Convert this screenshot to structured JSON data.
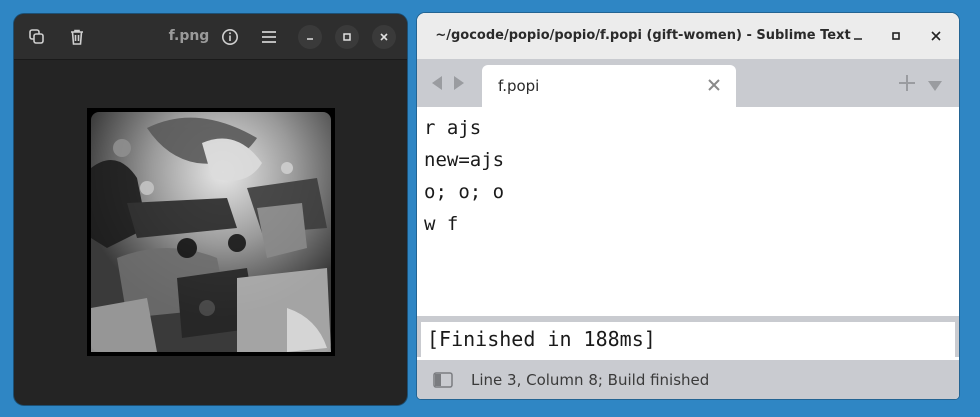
{
  "viewer": {
    "title": "f.png",
    "icons": [
      "copy-icon",
      "trash-icon",
      "info-icon",
      "menu-icon",
      "minimize-icon",
      "maximize-icon",
      "close-icon"
    ]
  },
  "sublime": {
    "window_title": "~/gocode/popio/popio/f.popi (gift-women) - Sublime Text",
    "tab_label": "f.popi",
    "code_lines": [
      "r ajs",
      "new=ajs",
      "o; o; o",
      "w f"
    ],
    "output": "[Finished in 188ms]",
    "status": "Line 3, Column 8; Build finished",
    "icons": [
      "back-arrow-icon",
      "forward-arrow-icon",
      "tab-close-icon",
      "add-tab-icon",
      "dropdown-icon",
      "panel-toggle-icon"
    ]
  }
}
